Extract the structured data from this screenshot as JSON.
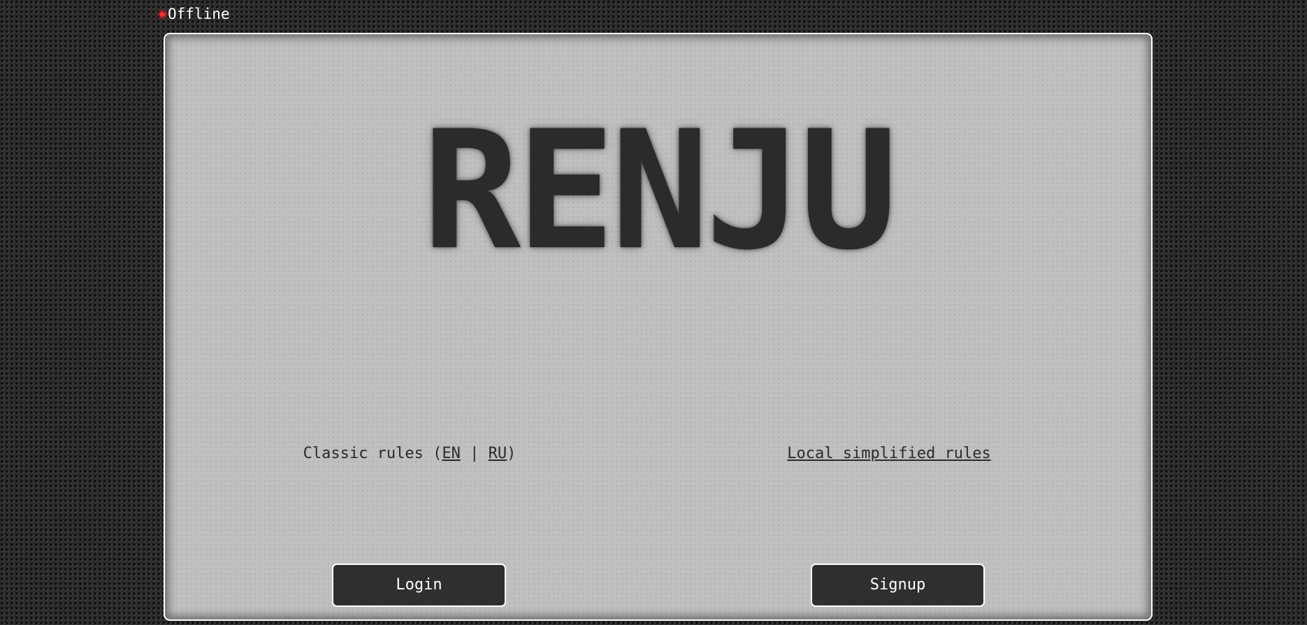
{
  "status": {
    "label": "Offline",
    "color": "#ff2a2a"
  },
  "panel": {
    "title": "RENJU",
    "classic_rules": {
      "prefix": "Classic rules (",
      "en_link": "EN",
      "separator": " | ",
      "ru_link": "RU",
      "suffix": ")"
    },
    "local_rules_link": "Local simplified rules",
    "buttons": {
      "login": "Login",
      "signup": "Signup"
    }
  },
  "colors": {
    "background": "#2a2a2a",
    "panel": "#c0c0c0",
    "text": "#2b2b2b",
    "button": "#2f2f2f"
  }
}
